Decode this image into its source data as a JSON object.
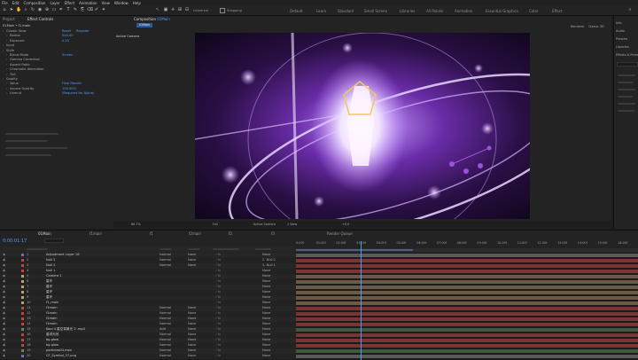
{
  "menu": [
    "File",
    "Edit",
    "Composition",
    "Layer",
    "Effect",
    "Animation",
    "View",
    "Window",
    "Help"
  ],
  "workspaces": [
    {
      "label": "Default",
      "active": false
    },
    {
      "label": "Learn",
      "active": false
    },
    {
      "label": "Standard",
      "active": false
    },
    {
      "label": "Small Screen",
      "active": false
    },
    {
      "label": "Libraries",
      "active": false
    },
    {
      "label": "All Panels",
      "active": false
    },
    {
      "label": "Animation",
      "active": false
    },
    {
      "label": "Essential Graphics",
      "active": false
    },
    {
      "label": "Color",
      "active": false
    },
    {
      "label": "Effect",
      "active": false
    }
  ],
  "toolbar": {
    "snapping": "Snapping"
  },
  "effect_controls": {
    "tab": "Effect Controls",
    "header": "01Main • f1 main",
    "properties": [
      {
        "name": "Classic Glow",
        "value": "Reset",
        "extra": "Register",
        "depth": 0
      },
      {
        "name": "Radius",
        "value": "500.00",
        "depth": 1
      },
      {
        "name": "Exposure",
        "value": "0.15",
        "depth": 1
      },
      {
        "name": "Input",
        "value": "",
        "depth": 0
      },
      {
        "name": "Style",
        "value": "",
        "depth": 0
      },
      {
        "name": "Blend Mode",
        "value": "Screen",
        "depth": 1
      },
      {
        "name": "Gamma Correction",
        "value": "",
        "depth": 1
      },
      {
        "name": "Aspect Ratio",
        "value": "",
        "depth": 1
      },
      {
        "name": "Chromatic Aberration",
        "value": "",
        "depth": 1
      },
      {
        "name": "Tint",
        "value": "",
        "depth": 1
      },
      {
        "name": "Quality",
        "value": "",
        "depth": 0
      },
      {
        "name": "Value",
        "value": "Final Render",
        "depth": 1
      },
      {
        "name": "Source Opacity",
        "value": "100.00%",
        "depth": 1
      },
      {
        "name": "Unmult",
        "value": "(Required for Alpha)",
        "depth": 1
      }
    ]
  },
  "composition": {
    "tab": "Composition",
    "name": "01Main",
    "active_camera": "Active Camera",
    "renderer": "Renderer",
    "camera_label": "Classic 3D"
  },
  "viewer_footer": {
    "zoom": "66.7%",
    "quality": "Full",
    "camera": "Active Camera",
    "views": "1 View",
    "offset": "+0.0"
  },
  "right_panel": {
    "tabs": [
      "Info",
      "Audio",
      "Preview",
      "Libraries",
      "Effects & Presets"
    ]
  },
  "timeline": {
    "tab": "01Main",
    "other_tabs": [
      "f1main",
      "f1",
      "f2main",
      "f2",
      "f3",
      "Render Queue"
    ],
    "timecode": "0:00:01:17",
    "ruler": [
      "0:00f",
      "01:00f",
      "02:00f",
      "03:00f",
      "04:00f",
      "05:00f",
      "06:00f",
      "07:00f",
      "08:00f",
      "09:00f",
      "10:00f",
      "11:00f",
      "12:00f",
      "13:00f",
      "14:00f",
      "15:00f",
      "16:00f",
      "17:00f"
    ],
    "layers": [
      {
        "num": "1",
        "name": "Adjustment Layer 16",
        "color": "#7a6bb0"
      },
      {
        "num": "2",
        "name": "Null 3",
        "color": "#c4433a"
      },
      {
        "num": "3",
        "name": "Null 2",
        "color": "#c4433a"
      },
      {
        "num": "4",
        "name": "Null 1",
        "color": "#c4433a"
      },
      {
        "num": "5",
        "name": "Camera 1",
        "color": "#b8a070"
      },
      {
        "num": "6",
        "name": "星环",
        "color": "#b8a070"
      },
      {
        "num": "7",
        "name": "星环",
        "color": "#b8a070"
      },
      {
        "num": "8",
        "name": "星环",
        "color": "#b8a070"
      },
      {
        "num": "9",
        "name": "星环",
        "color": "#b8a070"
      },
      {
        "num": "10",
        "name": "f1_main",
        "color": "#b8a070"
      },
      {
        "num": "11",
        "name": "f1main",
        "color": "#c4433a"
      },
      {
        "num": "12",
        "name": "f1main",
        "color": "#c4433a"
      },
      {
        "num": "13",
        "name": "f1main",
        "color": "#c4433a"
      },
      {
        "num": "14",
        "name": "f1main",
        "color": "#c4433a"
      },
      {
        "num": "15",
        "name": "Kool 4 星空背景光 2 .mp4",
        "color": "#5b8a5b"
      },
      {
        "num": "16",
        "name": "星球光效",
        "color": "#c4433a"
      },
      {
        "num": "17",
        "name": "bg glow",
        "color": "#c4433a"
      },
      {
        "num": "18",
        "name": "bg glow",
        "color": "#c4433a"
      },
      {
        "num": "19",
        "name": "particles04.mov",
        "color": "#5b8a5b"
      },
      {
        "num": "20",
        "name": "CF_Symbol_37.png",
        "color": "#7a6bb0"
      }
    ],
    "layer_modes": [
      "Normal",
      "Normal",
      "Normal",
      "",
      "",
      "",
      "",
      "",
      "",
      "",
      "Normal",
      "Normal",
      "Normal",
      "Normal",
      "Add",
      "Normal",
      "Normal",
      "Normal",
      "Normal",
      "Normal"
    ],
    "track_mattes": [
      "None",
      "None",
      "None",
      "",
      "",
      "",
      "",
      "",
      "",
      "",
      "None",
      "None",
      "None",
      "None",
      "None",
      "None",
      "None",
      "None",
      "None",
      "None"
    ],
    "parents": [
      "None",
      "2. Null 2",
      "3. Null 1",
      "None",
      "None",
      "None",
      "None",
      "None",
      "None",
      "None",
      "None",
      "None",
      "None",
      "None",
      "None",
      "None",
      "None",
      "None",
      "None",
      "None"
    ]
  },
  "colors": {
    "accent": "#4f9cff",
    "tl_bar_red": "#7b3534",
    "tl_bar_tan": "#6b5a45",
    "tl_bar_gray": "#5a5a5a",
    "tl_bar_green": "#3f5a3f",
    "playhead": "#4f9cff"
  }
}
